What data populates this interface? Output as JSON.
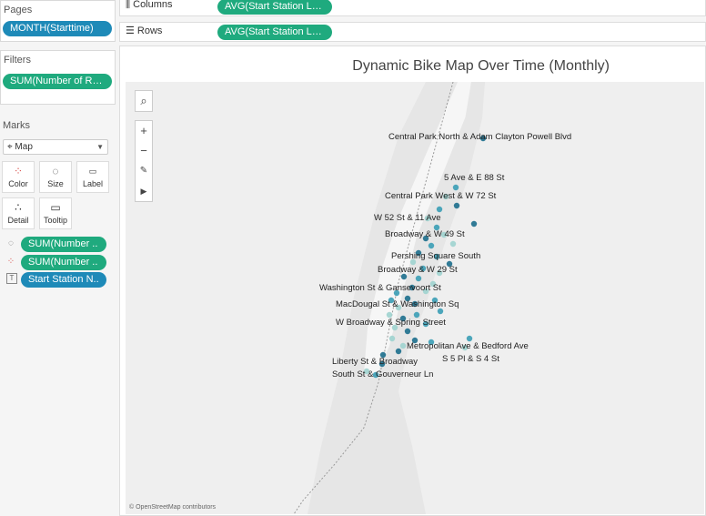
{
  "pages": {
    "title": "Pages",
    "pill": "MONTH(Starttime)"
  },
  "filters": {
    "title": "Filters",
    "pill": "SUM(Number of Rec.."
  },
  "marks": {
    "title": "Marks",
    "type": "Map",
    "buttons": {
      "color": "Color",
      "size": "Size",
      "label": "Label",
      "detail": "Detail",
      "tooltip": "Tooltip"
    },
    "fields": [
      "SUM(Number ..",
      "SUM(Number ..",
      "Start Station N.."
    ]
  },
  "shelves": {
    "columns_label": "Columns",
    "columns_pill": "AVG(Start Station Lon..",
    "rows_label": "Rows",
    "rows_pill": "AVG(Start Station Lati.."
  },
  "view": {
    "title": "Dynamic Bike Map Over Time (Monthly)",
    "attribution": "© OpenStreetMap contributors",
    "controls": {
      "zoom_in": "+",
      "zoom_out": "−",
      "play": "▶"
    },
    "station_labels": [
      "Central Park North & Adam Clayton Powell Blvd",
      "5 Ave & E 88 St",
      "Central Park West & W 72 St",
      "W 52 St & 11 Ave",
      "Broadway & W 49 St",
      "Pershing Square South",
      "Broadway & W 29 St",
      "Washington St & Gansevoort St",
      "MacDougal St & Washington Sq",
      "W Broadway & Spring Street",
      "Metropolitan Ave & Bedford Ave",
      "S 5 Pl & S 4 St",
      "Liberty St & Broadway",
      "South St & Gouverneur Ln"
    ]
  },
  "colors": {
    "pill_blue": "#1e8ab8",
    "pill_green": "#1faa7e",
    "dot_dark": "#1c6e8c",
    "dot_light": "#9fd3cf"
  }
}
